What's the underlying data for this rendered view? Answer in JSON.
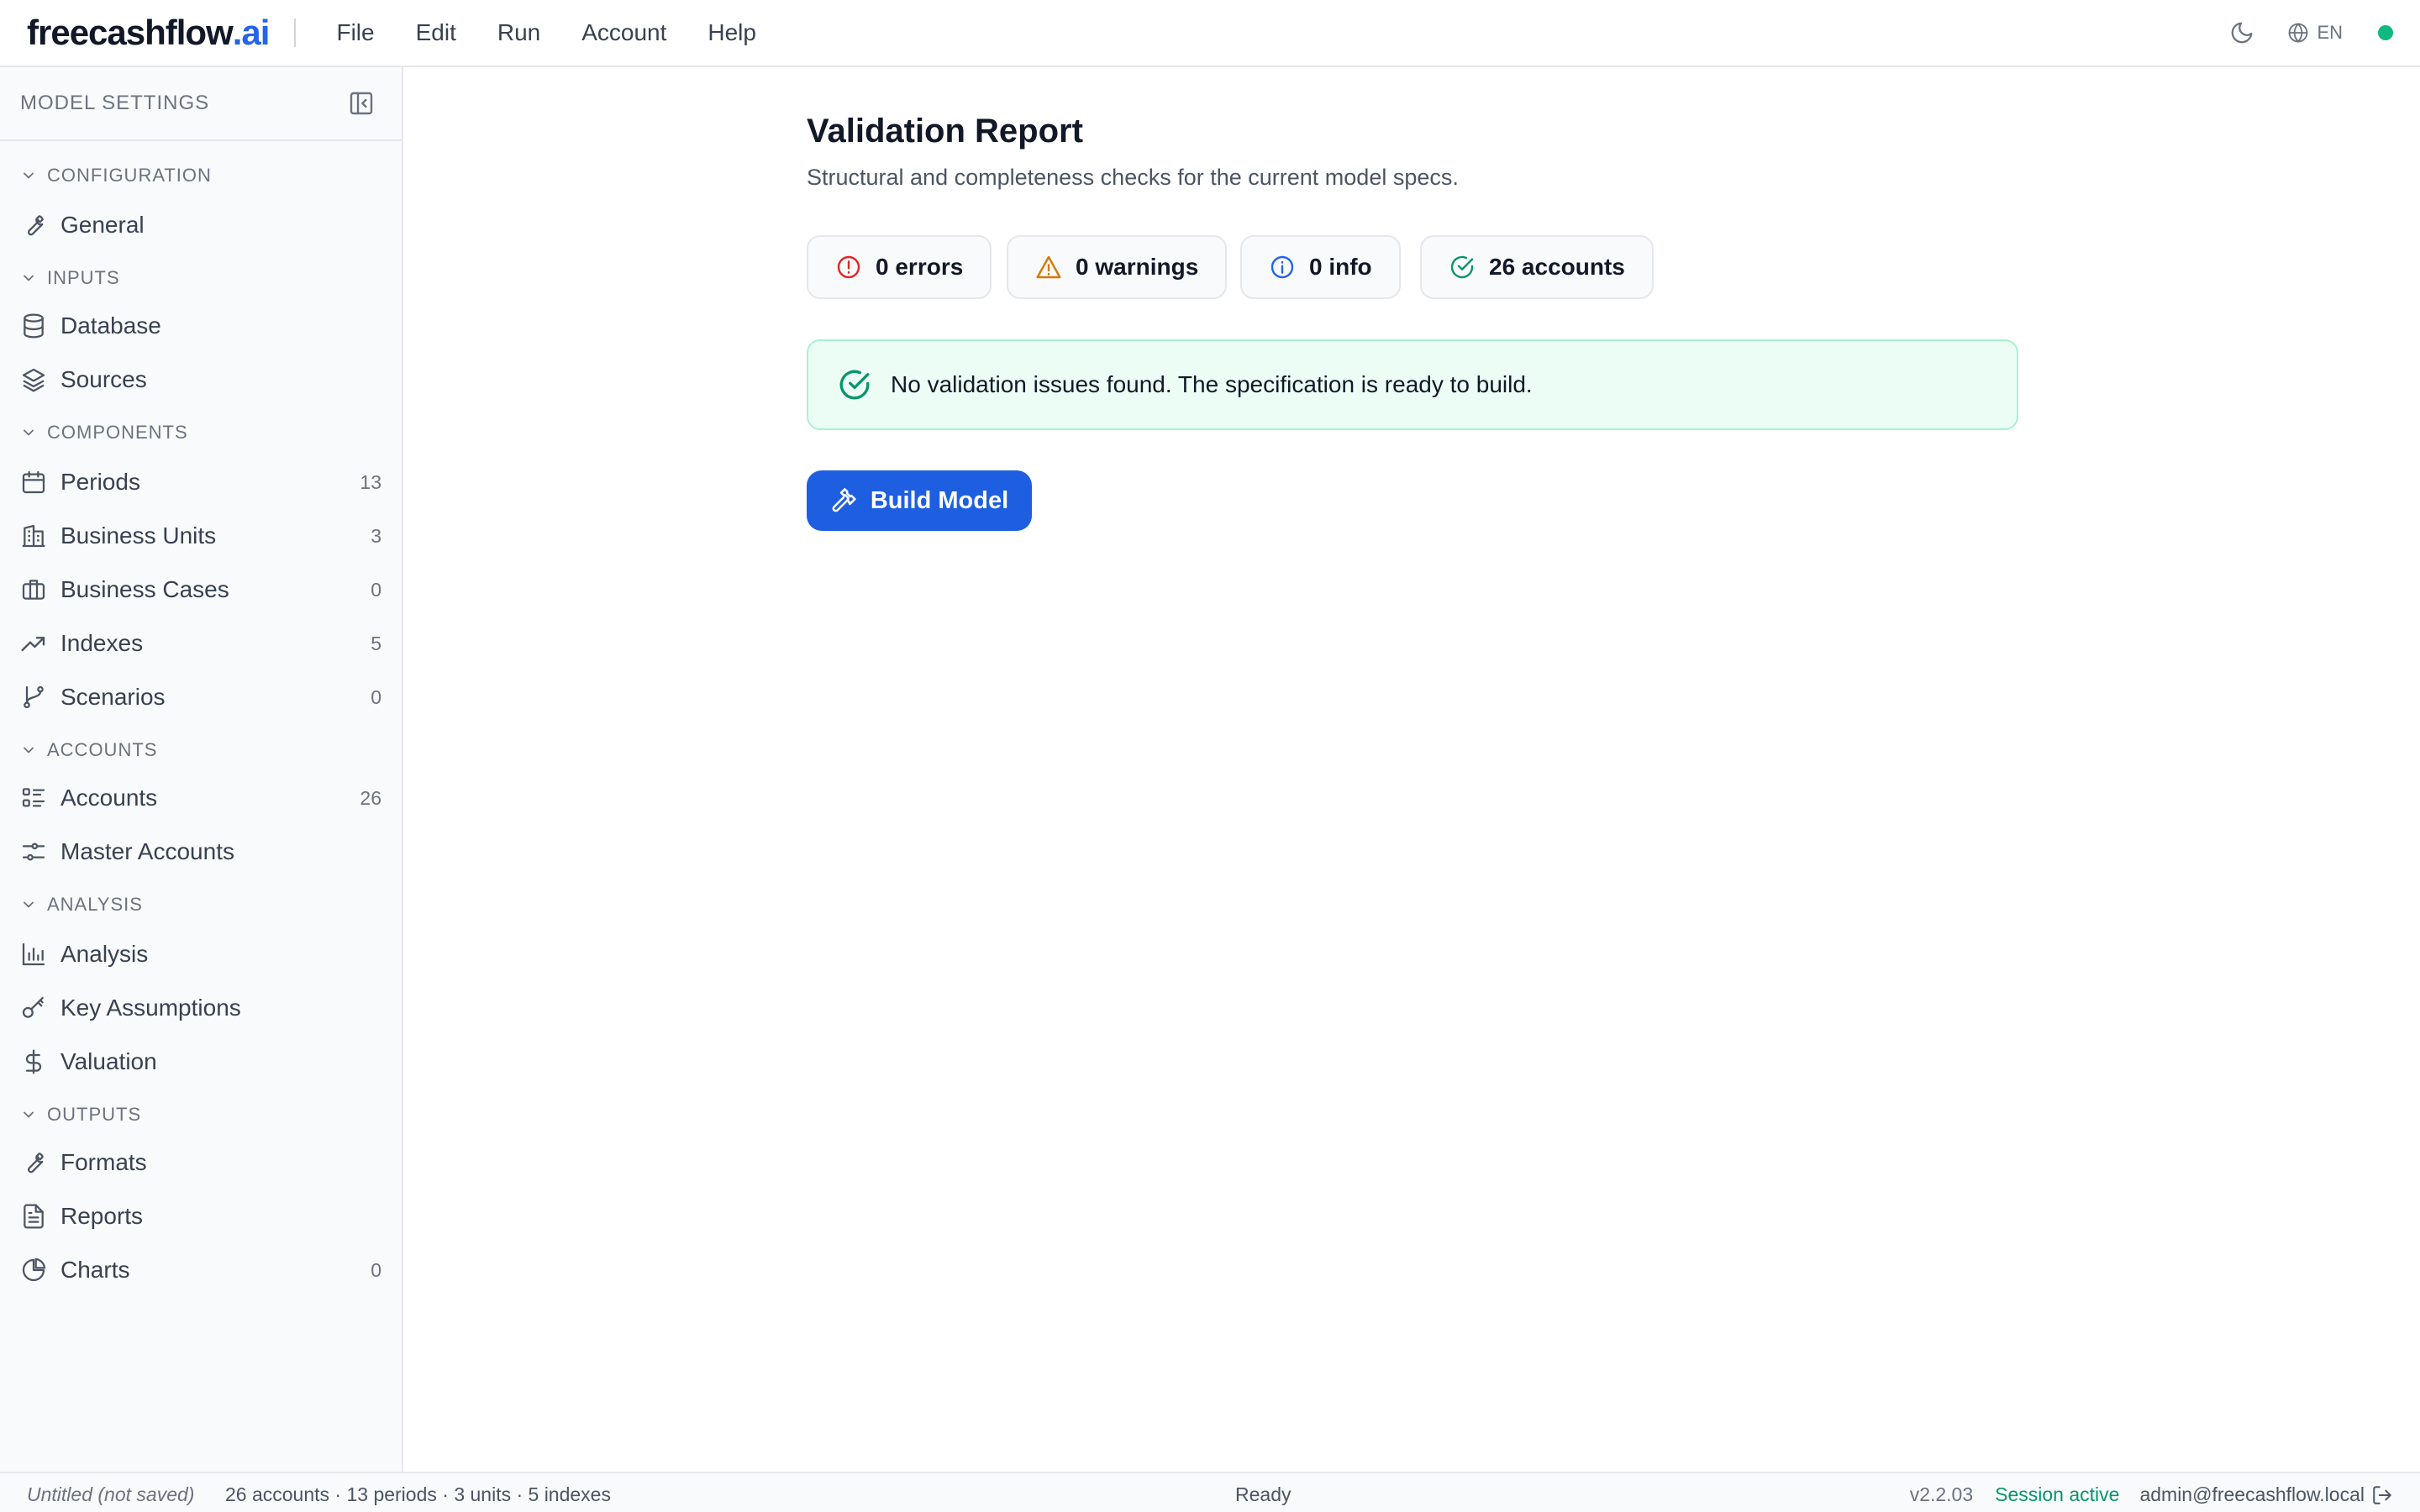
{
  "app": {
    "brand_main": "freecashflow",
    "brand_tld": ".ai",
    "language": "EN"
  },
  "menu": [
    "File",
    "Edit",
    "Run",
    "Account",
    "Help"
  ],
  "sidebar": {
    "title": "MODEL SETTINGS",
    "sections": {
      "configuration": "CONFIGURATION",
      "inputs": "INPUTS",
      "components": "COMPONENTS",
      "accounts": "ACCOUNTS",
      "analysis": "ANALYSIS",
      "outputs": "OUTPUTS"
    },
    "items": {
      "general": {
        "label": "General",
        "icon": "wrench-icon"
      },
      "database": {
        "label": "Database",
        "icon": "database-icon"
      },
      "sources": {
        "label": "Sources",
        "icon": "layers-icon"
      },
      "periods": {
        "label": "Periods",
        "count": "13",
        "icon": "calendar-icon"
      },
      "business_units": {
        "label": "Business Units",
        "count": "3",
        "icon": "building-icon"
      },
      "business_cases": {
        "label": "Business Cases",
        "count": "0",
        "icon": "briefcase-icon"
      },
      "indexes": {
        "label": "Indexes",
        "count": "5",
        "icon": "trending-up-icon"
      },
      "scenarios": {
        "label": "Scenarios",
        "count": "0",
        "icon": "git-branch-icon"
      },
      "accounts": {
        "label": "Accounts",
        "count": "26",
        "icon": "list-icon"
      },
      "master_accounts": {
        "label": "Master Accounts",
        "icon": "sliders-icon"
      },
      "analysis": {
        "label": "Analysis",
        "icon": "bar-chart-icon"
      },
      "key_assumptions": {
        "label": "Key Assumptions",
        "icon": "key-icon"
      },
      "valuation": {
        "label": "Valuation",
        "icon": "dollar-icon"
      },
      "formats": {
        "label": "Formats",
        "icon": "wrench-icon"
      },
      "reports": {
        "label": "Reports",
        "icon": "file-text-icon"
      },
      "charts": {
        "label": "Charts",
        "count": "0",
        "icon": "pie-chart-icon"
      }
    }
  },
  "main": {
    "title": "Validation Report",
    "subtitle": "Structural and completeness checks for the current model specs.",
    "chips": {
      "errors": "0 errors",
      "warnings": "0 warnings",
      "info": "0 info",
      "accounts": "26 accounts"
    },
    "success_message": "No validation issues found. The specification is ready to build.",
    "build_button": "Build Model"
  },
  "statusbar": {
    "document": "Untitled (not saved)",
    "stats": "26 accounts · 13 periods · 3 units · 5 indexes",
    "state": "Ready",
    "version": "v2.2.03",
    "session": "Session active",
    "user": "admin@freecashflow.local"
  },
  "colors": {
    "accent": "#2563eb",
    "button": "#1d5fe0",
    "success": "#059669",
    "error": "#dc2626",
    "warning": "#d97706",
    "info": "#2563eb",
    "status_dot": "#10b981"
  }
}
